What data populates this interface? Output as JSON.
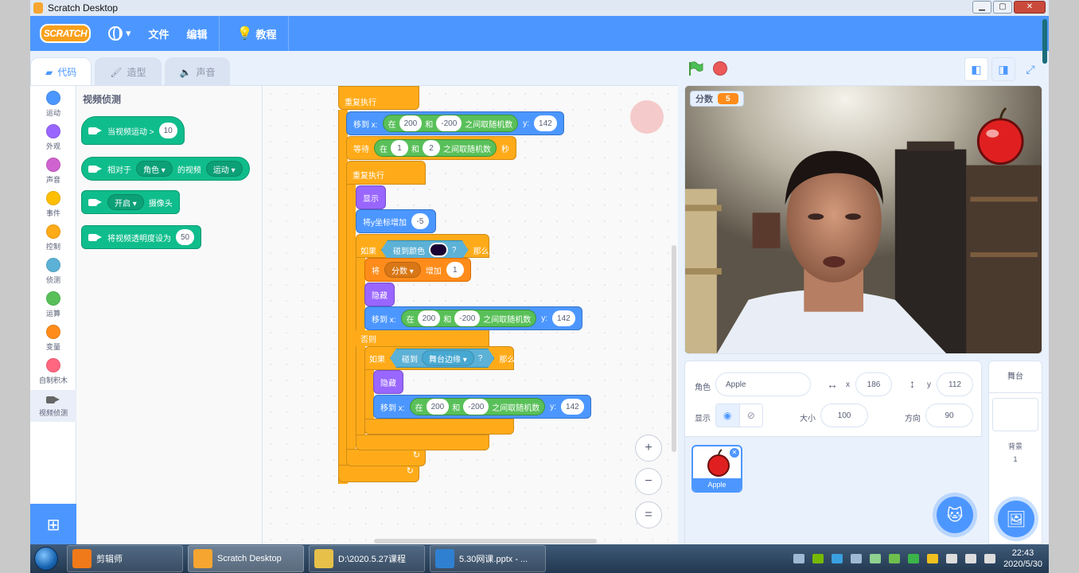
{
  "window": {
    "title": "Scratch Desktop",
    "btn_min": "▁",
    "btn_max": "▢",
    "btn_close": "✕"
  },
  "menu": {
    "logo": "SCRATCH",
    "file": "文件",
    "edit": "编辑",
    "tutorials": "教程"
  },
  "tabs": {
    "code": "代码",
    "costumes": "造型",
    "sounds": "声音"
  },
  "categories": [
    {
      "label": "运动",
      "color": "#4c97ff"
    },
    {
      "label": "外观",
      "color": "#9966ff"
    },
    {
      "label": "声音",
      "color": "#cf63cf"
    },
    {
      "label": "事件",
      "color": "#ffbf00"
    },
    {
      "label": "控制",
      "color": "#ffab19"
    },
    {
      "label": "侦测",
      "color": "#5cb1d6"
    },
    {
      "label": "运算",
      "color": "#59c059"
    },
    {
      "label": "变量",
      "color": "#ff8c1a"
    },
    {
      "label": "自制积木",
      "color": "#ff6680"
    },
    {
      "label": "视频侦测",
      "color": "#0fbd8c"
    }
  ],
  "palette": {
    "title": "视频侦测",
    "b1_text": "当视频运动 >",
    "b1_val": "10",
    "b2_a": "相对于",
    "b2_dd1": "角色 ▾",
    "b2_b": "的视频",
    "b2_dd2": "运动 ▾",
    "b3_dd": "开启 ▾",
    "b3_text": "摄像头",
    "b4_text": "将视频透明度设为",
    "b4_val": "50"
  },
  "script": {
    "forever1": "重复执行",
    "goto_label": "移到 x:",
    "pick_in": "在",
    "rand_from": "200",
    "and": "和",
    "rand_to": "-200",
    "pick_end": "之间取随机数",
    "y_label": "y:",
    "y_val": "142",
    "wait_label": "等待",
    "wait_from": "1",
    "wait_to": "2",
    "seconds": "秒",
    "forever2": "重复执行",
    "show": "显示",
    "change_y": "将y坐标增加",
    "change_y_val": "-5",
    "if": "如果",
    "touch_color": "碰到颜色",
    "question": "?",
    "then": "那么",
    "set_var": "将",
    "var_dd": "分数 ▾",
    "inc": "增加",
    "inc_val": "1",
    "hide": "隐藏",
    "else": "否则",
    "touch": "碰到",
    "edge_dd": "舞台边缘 ▾",
    "hide2": "隐藏"
  },
  "zoom": {
    "in": "+",
    "out": "−",
    "reset": "="
  },
  "stage": {
    "monitor_label": "分数",
    "monitor_value": "5"
  },
  "sprite_info": {
    "sprite_label": "角色",
    "sprite_name": "Apple",
    "x_label": "x",
    "x_val": "186",
    "y_label": "y",
    "y_val": "112",
    "show_label": "显示",
    "size_label": "大小",
    "size_val": "100",
    "dir_label": "方向",
    "dir_val": "90",
    "thumb_name": "Apple"
  },
  "stage_pane": {
    "title": "舞台",
    "backdrops_label": "背景",
    "backdrops_count": "1"
  },
  "taskbar": {
    "items": [
      "剪辑师",
      "Scratch Desktop",
      "D:\\2020.5.27课程",
      "5.30网课.pptx - ..."
    ],
    "time": "22:43",
    "date": "2020/5/30"
  }
}
